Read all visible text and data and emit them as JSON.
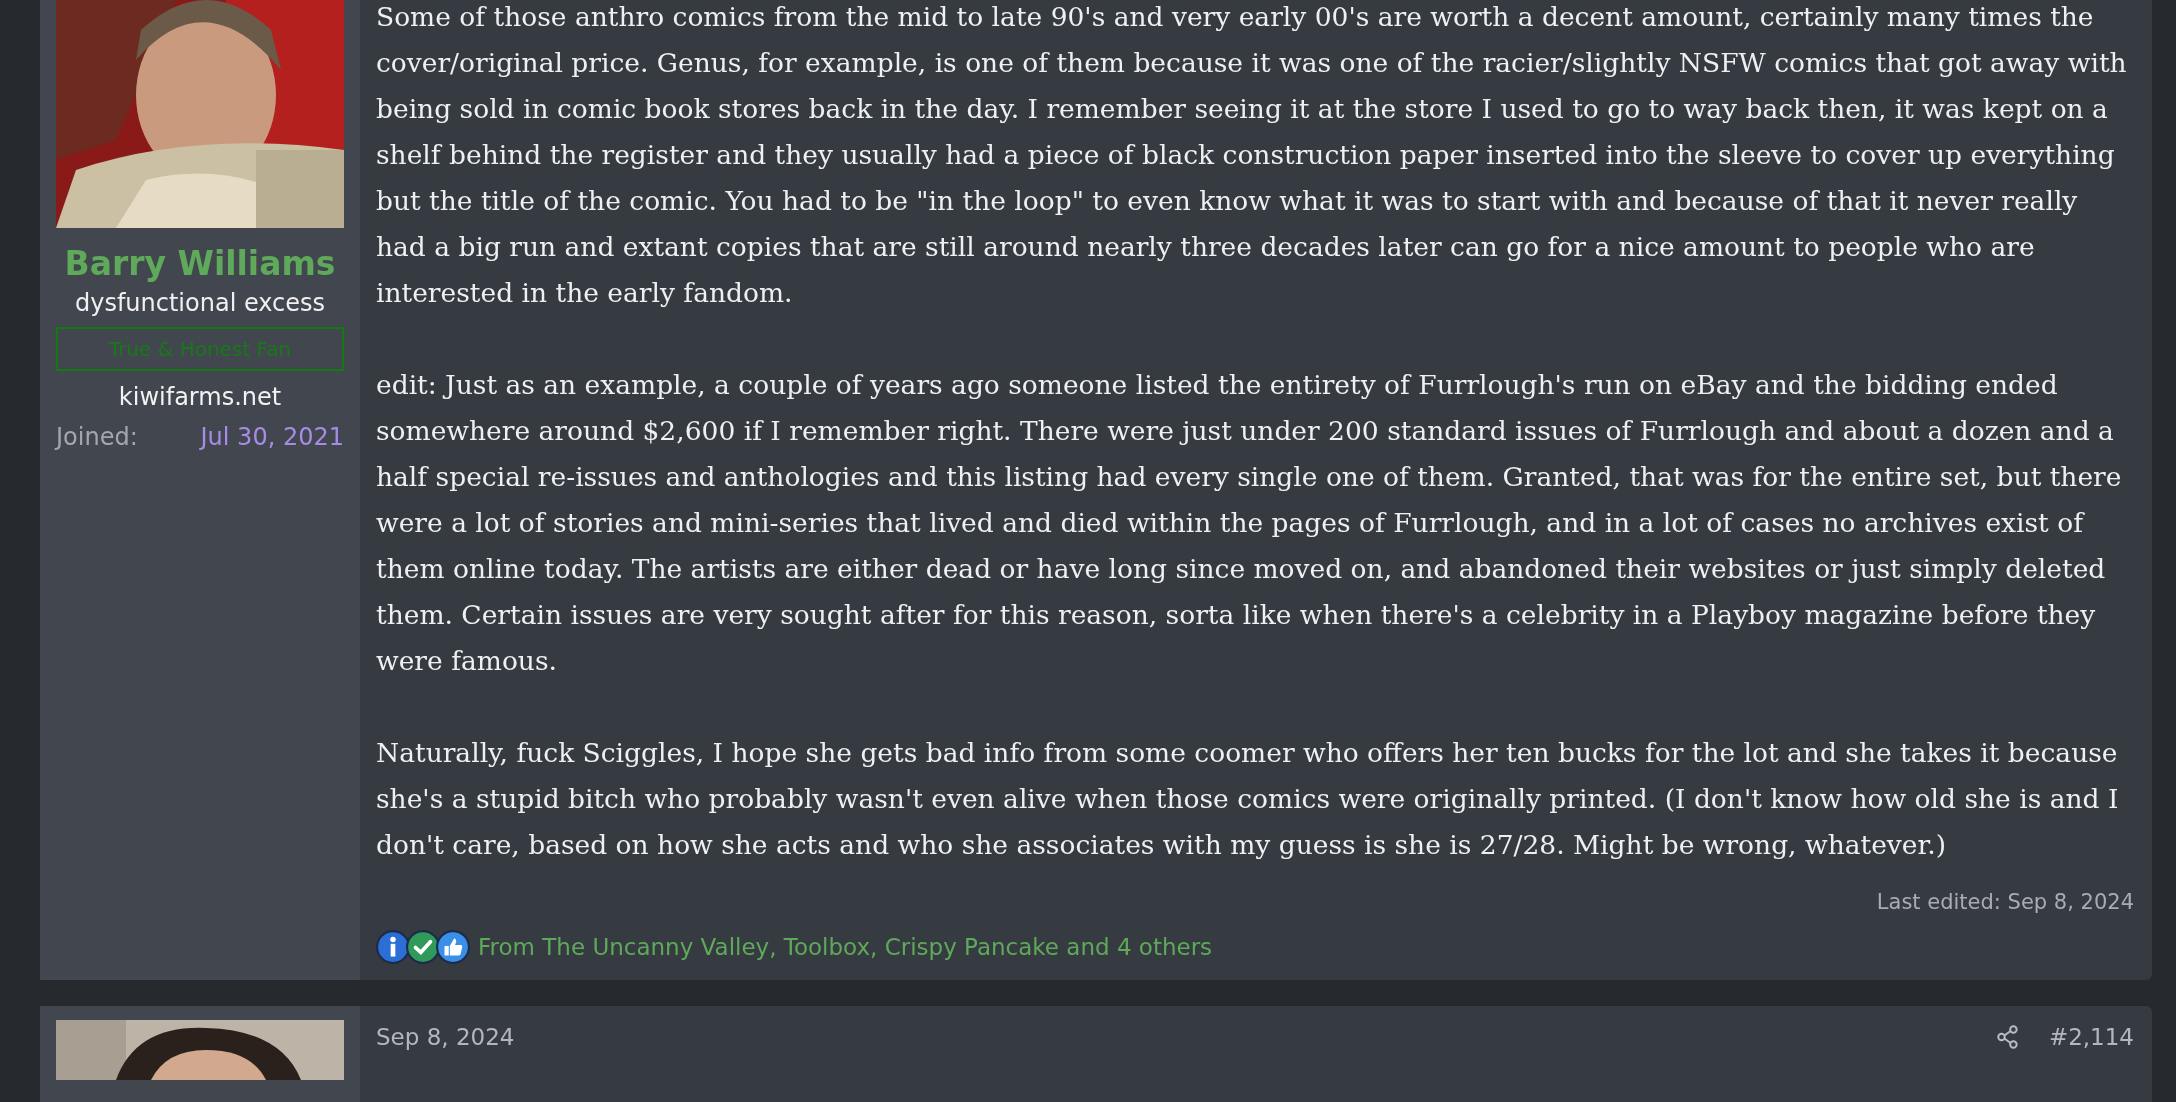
{
  "post": {
    "author": {
      "name": "Barry Williams",
      "user_title": "dysfunctional excess",
      "banner": "True & Honest Fan",
      "website": "kiwifarms.net",
      "joined_label": "Joined:",
      "joined_date": "Jul 30, 2021"
    },
    "paragraphs": [
      "Some of those anthro comics from the mid to late 90's and very early 00's are worth a decent amount, certainly many times the cover/original price. Genus, for example, is one of them because it was one of the racier/slightly NSFW comics that got away with being sold in comic book stores back in the day. I remember seeing it at the store I used to go to way back then, it was kept on a shelf behind the register and they usually had a piece of black construction paper inserted into the sleeve to cover up everything but the title of the comic. You had to be \"in the loop\" to even know what it was to start with and because of that it never really had a big run and extant copies that are still around nearly three decades later can go for a nice amount to people who are interested in the early fandom.",
      "edit: Just as an example, a couple of years ago someone listed the entirety of Furrlough's run on eBay and the bidding ended somewhere around $2,600 if I remember right. There were just under 200 standard issues of Furrlough and about a dozen and a half special re-issues and anthologies and this listing had every single one of them. Granted, that was for the entire set, but there were a lot of stories and mini-series that lived and died within the pages of Furrlough, and in a lot of cases no archives exist of them online today. The artists are either dead or have long since moved on, and abandoned their websites or just simply deleted them. Certain issues are very sought after for this reason, sorta like when there's a celebrity in a Playboy magazine before they were famous.",
      "Naturally, fuck Sciggles, I hope she gets bad info from some coomer who offers her ten bucks for the lot and she takes it because she's a stupid bitch who probably wasn't even alive when those comics were originally printed. (I don't know how old she is and I don't care, based on how she acts and who she associates with my guess is she is 27/28. Might be wrong, whatever.)"
    ],
    "last_edited": "Last edited: Sep 8, 2024",
    "reactions": {
      "icons": [
        {
          "kind": "info"
        },
        {
          "kind": "check"
        },
        {
          "kind": "like"
        }
      ],
      "text": "From The Uncanny Valley, Toolbox, Crispy Pancake and 4 others"
    }
  },
  "next_post": {
    "date": "Sep 8, 2024",
    "number": "#2,114"
  }
}
